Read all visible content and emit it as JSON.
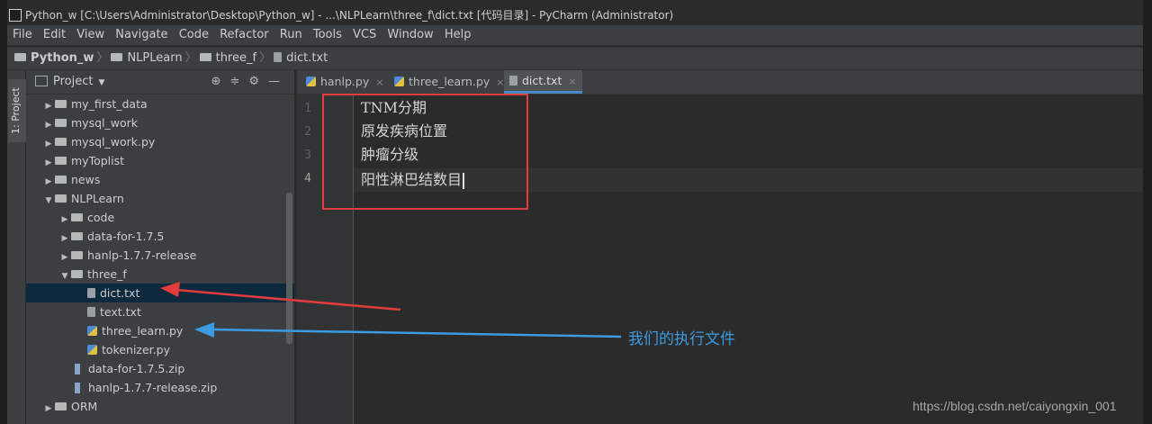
{
  "window": {
    "title": "Python_w [C:\\Users\\Administrator\\Desktop\\Python_w] - ...\\NLPLearn\\three_f\\dict.txt [代码目录] - PyCharm (Administrator)"
  },
  "menu": [
    "File",
    "Edit",
    "View",
    "Navigate",
    "Code",
    "Refactor",
    "Run",
    "Tools",
    "VCS",
    "Window",
    "Help"
  ],
  "breadcrumb": [
    "Python_w",
    "NLPLearn",
    "three_f",
    "dict.txt"
  ],
  "toolwindow_strip": {
    "label": "1: Project"
  },
  "project_panel": {
    "title": "Project",
    "tree": [
      {
        "label": "my_first_data",
        "type": "folder",
        "level": 1
      },
      {
        "label": "mysql_work",
        "type": "folder",
        "level": 1
      },
      {
        "label": "mysql_work.py",
        "type": "folder",
        "level": 1
      },
      {
        "label": "myToplist",
        "type": "folder",
        "level": 1
      },
      {
        "label": "news",
        "type": "folder",
        "level": 1
      },
      {
        "label": "NLPLearn",
        "type": "folder",
        "level": 1,
        "expanded": true
      },
      {
        "label": "code",
        "type": "folder",
        "level": 2
      },
      {
        "label": "data-for-1.7.5",
        "type": "folder",
        "level": 2
      },
      {
        "label": "hanlp-1.7.7-release",
        "type": "folder",
        "level": 2
      },
      {
        "label": "three_f",
        "type": "folder",
        "level": 2,
        "expanded": true
      },
      {
        "label": "dict.txt",
        "type": "text",
        "level": 3,
        "selected": true
      },
      {
        "label": "text.txt",
        "type": "text",
        "level": 3
      },
      {
        "label": "three_learn.py",
        "type": "python",
        "level": 3
      },
      {
        "label": "tokenizer.py",
        "type": "python",
        "level": 3
      },
      {
        "label": "data-for-1.7.5.zip",
        "type": "zip",
        "level": 2
      },
      {
        "label": "hanlp-1.7.7-release.zip",
        "type": "zip",
        "level": 2
      },
      {
        "label": "ORM",
        "type": "folder",
        "level": 1
      }
    ]
  },
  "editor": {
    "tabs": [
      {
        "label": "hanlp.py",
        "active": false
      },
      {
        "label": "three_learn.py",
        "active": false
      },
      {
        "label": "dict.txt",
        "active": true
      }
    ],
    "lines": [
      "TNM分期",
      "原发疾病位置",
      "肿瘤分级",
      "阳性淋巴结数目"
    ],
    "line_numbers": [
      "1",
      "2",
      "3",
      "4"
    ]
  },
  "annotation": {
    "text": "我们的执行文件"
  },
  "watermark": "https://blog.csdn.net/caiyongxin_001",
  "colors": {
    "red_arrow": "#e23c3c",
    "blue_arrow": "#3b9be3",
    "selection": "#0d293e"
  }
}
